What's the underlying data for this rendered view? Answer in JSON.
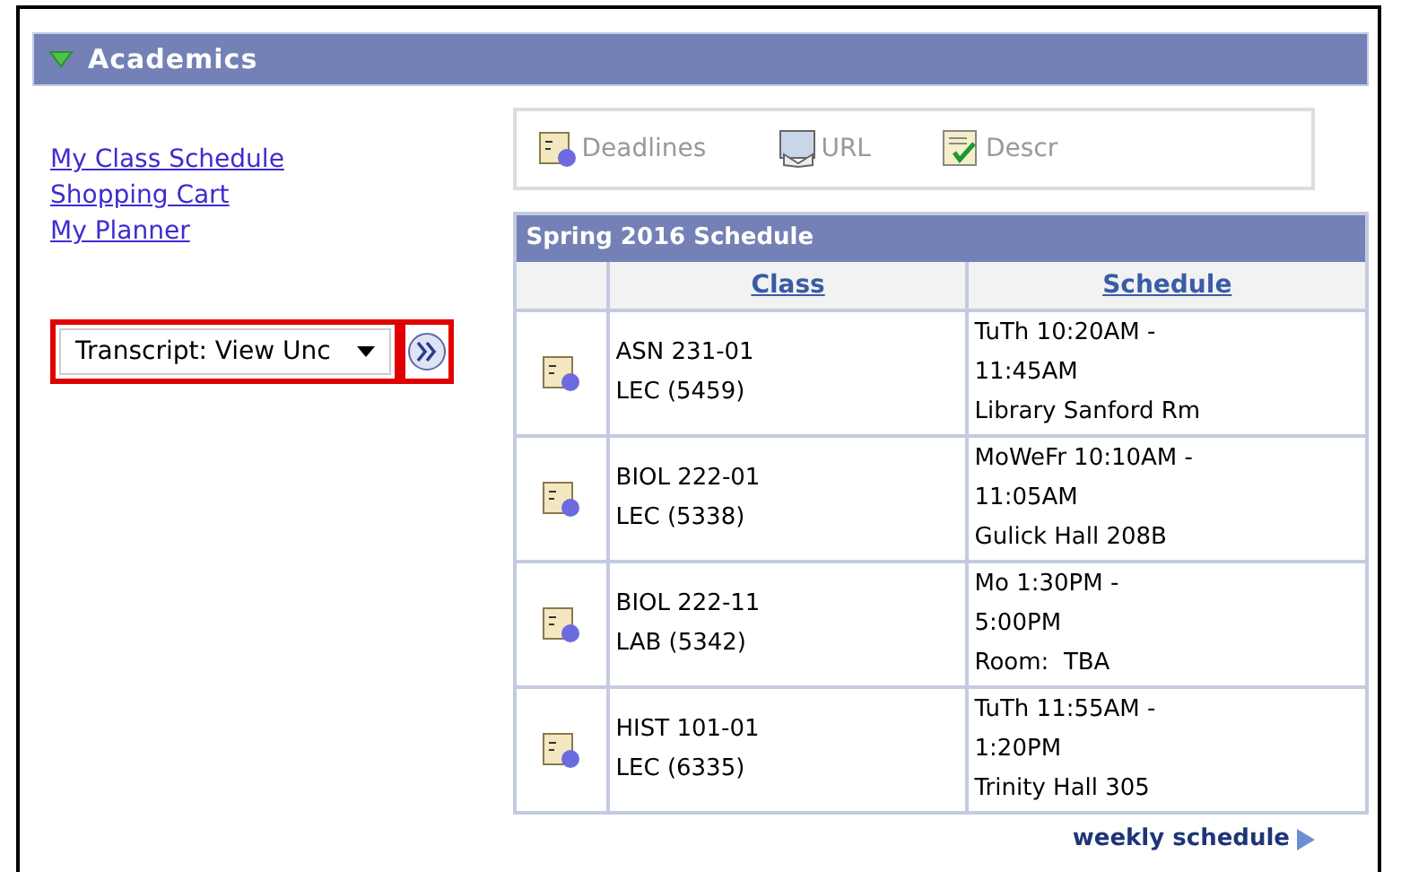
{
  "header": {
    "title": "Academics",
    "expanded": true
  },
  "links": [
    "My Class Schedule",
    "Shopping Cart",
    "My Planner"
  ],
  "transcript": {
    "value": "Transcript: View Unc",
    "highlighted": true
  },
  "toolbar": [
    {
      "kind": "deadlines",
      "label": "Deadlines"
    },
    {
      "kind": "url",
      "label": "URL"
    },
    {
      "kind": "descr",
      "label": "Descr"
    }
  ],
  "schedule": {
    "title": "Spring 2016 Schedule",
    "columns": [
      "Class",
      "Schedule"
    ],
    "rows": [
      {
        "class": [
          "ASN 231-01",
          "LEC (5459)"
        ],
        "schedule": [
          "TuTh 10:20AM -",
          "11:45AM",
          "Library Sanford Rm"
        ]
      },
      {
        "class": [
          "BIOL 222-01",
          "LEC (5338)"
        ],
        "schedule": [
          "MoWeFr 10:10AM -",
          "11:05AM",
          "Gulick Hall 208B"
        ]
      },
      {
        "class": [
          "BIOL 222-11",
          "LAB (5342)"
        ],
        "schedule": [
          "Mo 1:30PM -",
          "5:00PM",
          "Room:  TBA"
        ]
      },
      {
        "class": [
          "HIST 101-01",
          "LEC (6335)"
        ],
        "schedule": [
          "TuTh 11:55AM -",
          "1:20PM",
          "Trinity Hall 305"
        ]
      }
    ]
  },
  "weekly_link": "weekly schedule"
}
